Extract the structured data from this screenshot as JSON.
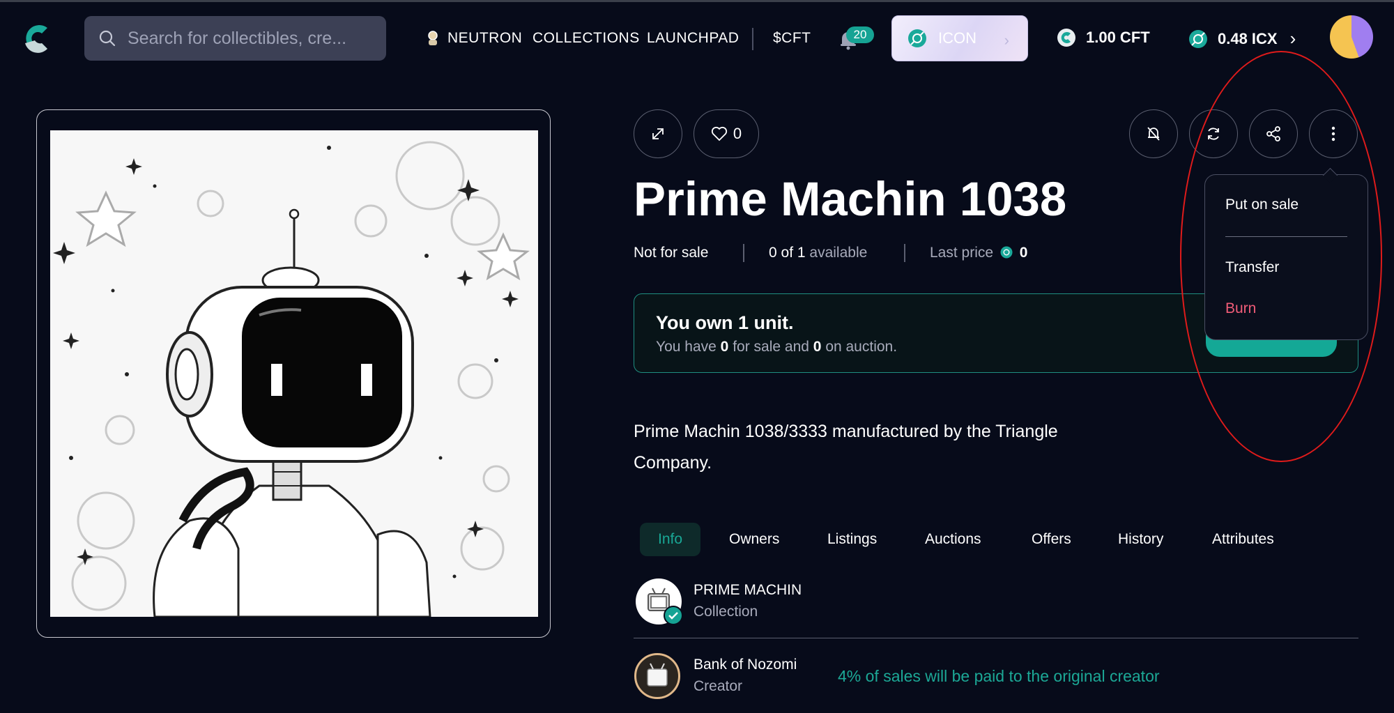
{
  "nav": {
    "search_placeholder": "Search for collectibles, cre...",
    "links": [
      "NEUTRON",
      "COLLECTIONS",
      "LAUNCHPAD",
      "$CFT"
    ],
    "notification_count": "20",
    "network_label": "ICON",
    "cft_balance": "1.00 CFT",
    "icx_balance": "0.48 ICX"
  },
  "nft": {
    "like_count": "0",
    "title": "Prime Machin 1038",
    "status": "Not for sale",
    "available_count": "0 of 1",
    "available_label": "available",
    "last_price_label": "Last price",
    "last_price": "0",
    "description": "Prime Machin 1038/3333 manufactured by the Triangle Company."
  },
  "ownership": {
    "title": "You own 1 unit.",
    "sub_prefix": "You have",
    "for_sale": "0",
    "sub_middle": "for sale and",
    "on_auction": "0",
    "sub_suffix": "on auction."
  },
  "menu": {
    "put_on_sale": "Put on sale",
    "transfer": "Transfer",
    "burn": "Burn"
  },
  "tabs": [
    "Info",
    "Owners",
    "Listings",
    "Auctions",
    "Offers",
    "History",
    "Attributes"
  ],
  "info": {
    "collection_name": "PRIME MACHIN",
    "collection_role": "Collection",
    "creator_name": "Bank of Nozomi",
    "creator_role": "Creator",
    "royalty_text": "4% of sales will be paid to the original creator"
  },
  "colors": {
    "background": "#070b1a",
    "accent": "#16a394",
    "danger": "#f15c78",
    "highlight": "#e01b1b"
  }
}
